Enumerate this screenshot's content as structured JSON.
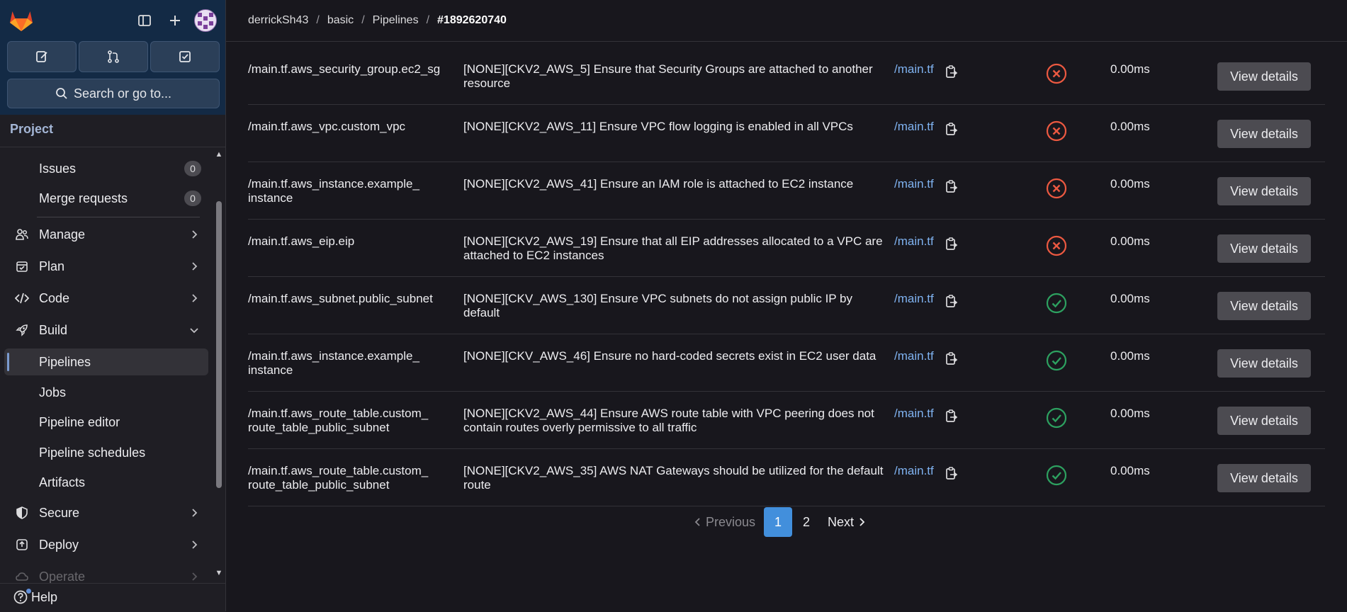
{
  "breadcrumb": {
    "items": [
      "derrickSh43",
      "basic",
      "Pipelines"
    ],
    "current": "#1892620740",
    "separator": "/"
  },
  "sidebar": {
    "search_label": "Search or go to...",
    "section_title": "Project",
    "issues": {
      "label": "Issues",
      "count": "0"
    },
    "merge_requests": {
      "label": "Merge requests",
      "count": "0"
    },
    "items": [
      {
        "label": "Manage",
        "icon": "users-icon"
      },
      {
        "label": "Plan",
        "icon": "calendar-icon"
      },
      {
        "label": "Code",
        "icon": "code-icon"
      },
      {
        "label": "Build",
        "icon": "rocket-icon"
      },
      {
        "label": "Pipelines"
      },
      {
        "label": "Jobs"
      },
      {
        "label": "Pipeline editor"
      },
      {
        "label": "Pipeline schedules"
      },
      {
        "label": "Artifacts"
      },
      {
        "label": "Secure",
        "icon": "shield-icon"
      },
      {
        "label": "Deploy",
        "icon": "deploy-icon"
      },
      {
        "label": "Operate",
        "icon": "cloud-icon"
      }
    ],
    "help_label": "Help"
  },
  "colors": {
    "fail": "#ec5941",
    "pass": "#2da160",
    "link": "#7fb2f0",
    "active_page": "#428fdc"
  },
  "rows": [
    {
      "name": "/main.tf.aws_security_group.ec2_sg",
      "description": "[NONE][CKV2_AWS_5] Ensure that Security Groups are attached to another resource",
      "file": "/main.tf",
      "status": "failed",
      "time": "0.00ms",
      "action": "View details"
    },
    {
      "name": "/main.tf.aws_vpc.custom_vpc",
      "description": "[NONE][CKV2_AWS_11] Ensure VPC flow logging is enabled in all VPCs",
      "file": "/main.tf",
      "status": "failed",
      "time": "0.00ms",
      "action": "View details"
    },
    {
      "name": "/main.tf.aws_instance.example_ instance",
      "description": "[NONE][CKV2_AWS_41] Ensure an IAM role is attached to EC2 instance",
      "file": "/main.tf",
      "status": "failed",
      "time": "0.00ms",
      "action": "View details"
    },
    {
      "name": "/main.tf.aws_eip.eip",
      "description": "[NONE][CKV2_AWS_19] Ensure that all EIP addresses allocated to a VPC are attached to EC2 instances",
      "file": "/main.tf",
      "status": "failed",
      "time": "0.00ms",
      "action": "View details"
    },
    {
      "name": "/main.tf.aws_subnet.public_subnet",
      "description": "[NONE][CKV_AWS_130] Ensure VPC subnets do not assign public IP by default",
      "file": "/main.tf",
      "status": "passed",
      "time": "0.00ms",
      "action": "View details"
    },
    {
      "name": "/main.tf.aws_instance.example_ instance",
      "description": "[NONE][CKV_AWS_46] Ensure no hard-coded secrets exist in EC2 user data",
      "file": "/main.tf",
      "status": "passed",
      "time": "0.00ms",
      "action": "View details"
    },
    {
      "name": "/main.tf.aws_route_table.custom_ route_table_public_subnet",
      "description": "[NONE][CKV2_AWS_44] Ensure AWS route table with VPC peering does not contain routes overly permissive to all traffic",
      "file": "/main.tf",
      "status": "passed",
      "time": "0.00ms",
      "action": "View details"
    },
    {
      "name": "/main.tf.aws_route_table.custom_ route_table_public_subnet",
      "description": "[NONE][CKV2_AWS_35] AWS NAT Gateways should be utilized for the default route",
      "file": "/main.tf",
      "status": "passed",
      "time": "0.00ms",
      "action": "View details"
    }
  ],
  "pagination": {
    "previous": "Previous",
    "pages": [
      "1",
      "2"
    ],
    "current": "1",
    "next": "Next"
  }
}
